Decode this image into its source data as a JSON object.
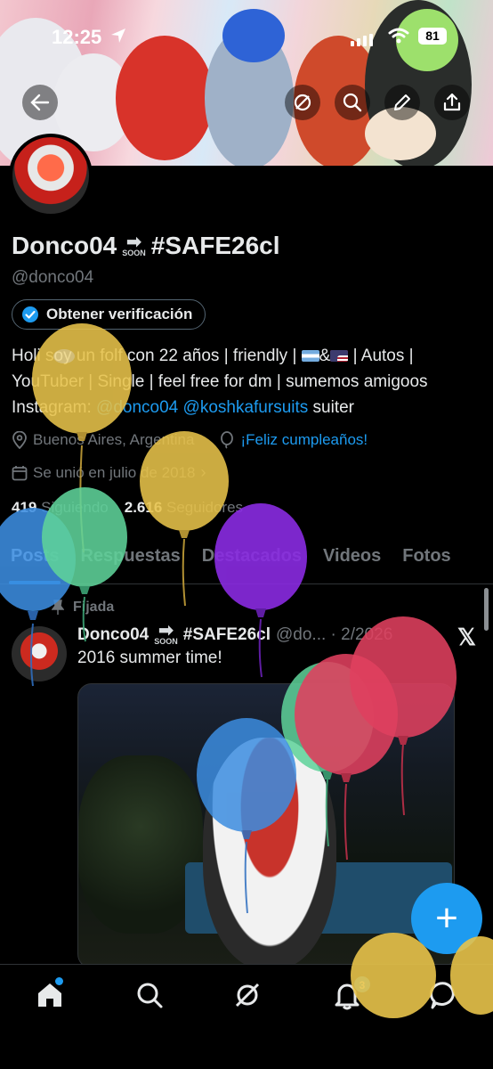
{
  "status_bar": {
    "time": "12:25",
    "battery": "81"
  },
  "profile": {
    "display_name": "Donco04",
    "soon_label": "SOON",
    "display_name_tag": "#SAFE26cl",
    "handle": "@donco04",
    "verify_button": "Obtener verificación",
    "bio_line1": "Holi soy un folf con 22 años | friendly |",
    "bio_amp": "&",
    "bio_line1_end": "| Autos |",
    "bio_line2": "YouTuber | Single | feel free for dm | sumemos amigoos",
    "bio_line3_prefix": "Instagram:",
    "bio_link1": "@donco04",
    "bio_link2": "@koshkafursuits",
    "bio_line3_suffix": "suiter",
    "location": "Buenos Aires, Argentina",
    "birthday": "¡Feliz cumpleaños!",
    "joined": "Se unió en julio de 2018",
    "following_count": "419",
    "following_label": "Siguiendo",
    "followers_count": "2.616",
    "followers_label": "Seguidores"
  },
  "tabs": [
    {
      "label": "Posts",
      "active": true
    },
    {
      "label": "Respuestas",
      "active": false
    },
    {
      "label": "Destacados",
      "active": false
    },
    {
      "label": "Videos",
      "active": false
    },
    {
      "label": "Fotos",
      "active": false
    }
  ],
  "post": {
    "pinned_label": "Fijada",
    "author": "Donco04",
    "author_tag": "#SAFE26cl",
    "handle_date": "@do... · 2/2026",
    "text": "2016 summer time!",
    "image_label": "Fursuiter en una piscina de noche"
  },
  "fab_label": "+",
  "nav": {
    "notifications_badge": "3"
  },
  "colors": {
    "accent": "#1d9bf0",
    "background": "#000000",
    "muted": "#71767b"
  },
  "icons": [
    "back-icon",
    "grok-icon",
    "search-icon",
    "edit-icon",
    "share-icon",
    "location-icon",
    "balloon-icon",
    "calendar-icon",
    "pin-icon",
    "x-logo-icon",
    "home-icon",
    "explore-icon",
    "notifications-icon",
    "messages-icon"
  ]
}
